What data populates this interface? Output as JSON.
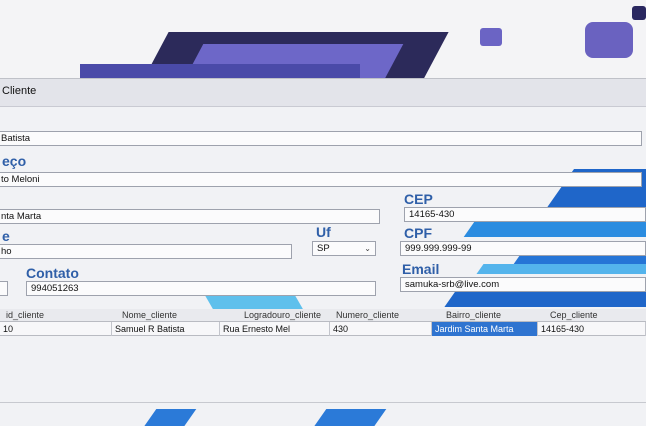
{
  "window": {
    "title": "Cliente"
  },
  "form": {
    "nome_value": "Batista",
    "endereco_label": "eço",
    "endereco_value": "to Meloni",
    "bairro_value": "nta Marta",
    "cep_label": "CEP",
    "cep_value": "14165-430",
    "cidade_label": "e",
    "cidade_value": "ho",
    "uf_label": "Uf",
    "uf_value": "SP",
    "cpf_label": "CPF",
    "cpf_value": "999.999.999-99",
    "contato_label": "Contato",
    "contato_value": "994051263",
    "email_label": "Email",
    "email_value": "samuka-srb@live.com"
  },
  "grid": {
    "columns": [
      "id_cliente",
      "Nome_cliente",
      "Logradouro_cliente",
      "Numero_cliente",
      "Bairro_cliente",
      "Cep_cliente"
    ],
    "rows": [
      [
        "10",
        "Samuel R Batista",
        "Rua Ernesto Mel",
        "430",
        "Jardim Santa Marta",
        "14165-430"
      ]
    ]
  },
  "colors": {
    "label_blue": "#2f5fa8",
    "selection": "#2f74d0"
  }
}
